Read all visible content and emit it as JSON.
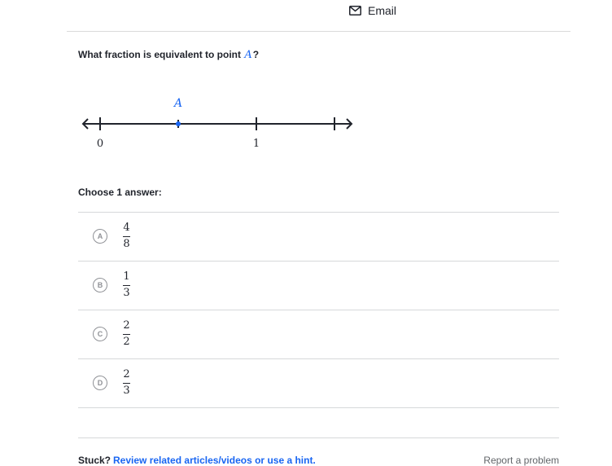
{
  "header": {
    "email_label": "Email",
    "email_icon": "envelope-icon"
  },
  "question": {
    "prefix": "What fraction is equivalent to point ",
    "variable": "A",
    "suffix": "?"
  },
  "number_line": {
    "point_label": "A",
    "point_value": 0.5,
    "tick_values": [
      0,
      0.5,
      1,
      1.5
    ],
    "tick_labels": [
      "0",
      "1"
    ],
    "range": [
      0,
      1.5
    ],
    "point_color": "#1865f2"
  },
  "choose_label": "Choose 1 answer:",
  "choices": [
    {
      "letter": "A",
      "numerator": "4",
      "denominator": "8"
    },
    {
      "letter": "B",
      "numerator": "1",
      "denominator": "3"
    },
    {
      "letter": "C",
      "numerator": "2",
      "denominator": "2"
    },
    {
      "letter": "D",
      "numerator": "2",
      "denominator": "3"
    }
  ],
  "footer": {
    "stuck_label": "Stuck?",
    "hint_link": "Review related articles/videos or use a hint.",
    "report_label": "Report a problem"
  },
  "colors": {
    "accent": "#1865f2",
    "text": "#21242c",
    "muted": "#626569"
  }
}
